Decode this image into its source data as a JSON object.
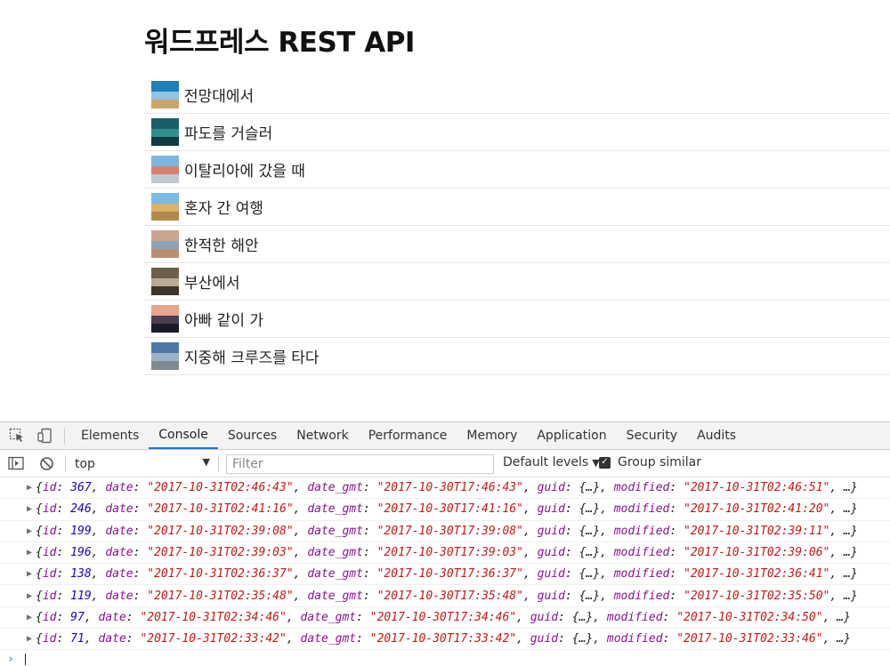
{
  "page": {
    "title": "워드프레스 REST API",
    "posts": [
      {
        "title": "전망대에서",
        "thumb": [
          "#1f7fb8",
          "#8ec5e3",
          "#c9a56b"
        ]
      },
      {
        "title": "파도를 거슬러",
        "thumb": [
          "#1a5d6a",
          "#2f8f8f",
          "#0f3b44"
        ]
      },
      {
        "title": "이탈리아에 갔을 때",
        "thumb": [
          "#7fb6de",
          "#d88070",
          "#c2c8cf"
        ]
      },
      {
        "title": "혼자 간 여행",
        "thumb": [
          "#7db8e6",
          "#d9b36a",
          "#b08a4c"
        ]
      },
      {
        "title": "한적한 해안",
        "thumb": [
          "#c8a68e",
          "#8fa3b8",
          "#b98f74"
        ]
      },
      {
        "title": "부산에서",
        "thumb": [
          "#6d5f4c",
          "#b9ab92",
          "#3e352a"
        ]
      },
      {
        "title": "아빠 같이 가",
        "thumb": [
          "#e7a58c",
          "#4c3d52",
          "#1c1c28"
        ]
      },
      {
        "title": "지중해 크루즈를 타다",
        "thumb": [
          "#4f78a8",
          "#9ab3c9",
          "#7f8a8f"
        ]
      }
    ]
  },
  "devtools": {
    "tabs": [
      {
        "label": "Elements",
        "active": false
      },
      {
        "label": "Console",
        "active": true
      },
      {
        "label": "Sources",
        "active": false
      },
      {
        "label": "Network",
        "active": false
      },
      {
        "label": "Performance",
        "active": false
      },
      {
        "label": "Memory",
        "active": false
      },
      {
        "label": "Application",
        "active": false
      },
      {
        "label": "Security",
        "active": false
      },
      {
        "label": "Audits",
        "active": false
      }
    ],
    "toolbar": {
      "context": "top",
      "filter_placeholder": "Filter",
      "levels_label": "Default levels",
      "group_similar_label": "Group similar",
      "group_similar_checked": true
    },
    "logs": [
      {
        "id": "367",
        "date": "\"2017-10-31T02:46:43\"",
        "date_gmt": "\"2017-10-30T17:46:43\"",
        "modified": "\"2017-10-31T02:46:51\""
      },
      {
        "id": "246",
        "date": "\"2017-10-31T02:41:16\"",
        "date_gmt": "\"2017-10-30T17:41:16\"",
        "modified": "\"2017-10-31T02:41:20\""
      },
      {
        "id": "199",
        "date": "\"2017-10-31T02:39:08\"",
        "date_gmt": "\"2017-10-30T17:39:08\"",
        "modified": "\"2017-10-31T02:39:11\""
      },
      {
        "id": "196",
        "date": "\"2017-10-31T02:39:03\"",
        "date_gmt": "\"2017-10-30T17:39:03\"",
        "modified": "\"2017-10-31T02:39:06\""
      },
      {
        "id": "138",
        "date": "\"2017-10-31T02:36:37\"",
        "date_gmt": "\"2017-10-30T17:36:37\"",
        "modified": "\"2017-10-31T02:36:41\""
      },
      {
        "id": "119",
        "date": "\"2017-10-31T02:35:48\"",
        "date_gmt": "\"2017-10-30T17:35:48\"",
        "modified": "\"2017-10-31T02:35:50\""
      },
      {
        "id": "97",
        "date": "\"2017-10-31T02:34:46\"",
        "date_gmt": "\"2017-10-30T17:34:46\"",
        "modified": "\"2017-10-31T02:34:50\""
      },
      {
        "id": "71",
        "date": "\"2017-10-31T02:33:42\"",
        "date_gmt": "\"2017-10-30T17:33:42\"",
        "modified": "\"2017-10-31T02:33:46\""
      }
    ],
    "log_text": {
      "open": "{",
      "k_id": "id",
      "k_date": "date",
      "k_date_gmt": "date_gmt",
      "k_guid": "guid",
      "k_modified": "modified",
      "colon": ": ",
      "comma": ", ",
      "guid_val": "{…}",
      "tail": ", …}"
    },
    "prompt_symbol": "›"
  },
  "colors": {
    "accent": "#1a73e8",
    "number": "#1c00cf",
    "string": "#c41a16",
    "key": "#881391"
  }
}
